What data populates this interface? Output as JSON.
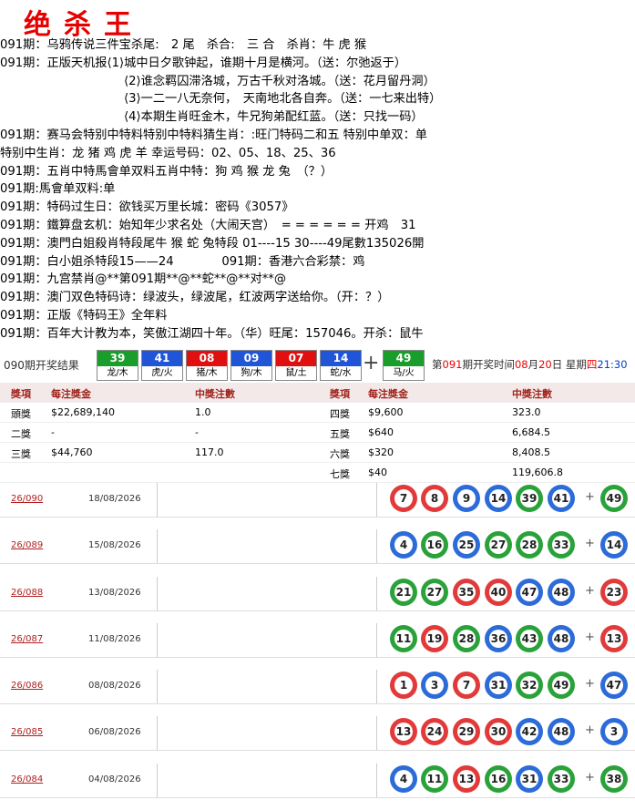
{
  "title": "绝杀王",
  "lines": [
    "091期：乌鸦传说三件宝杀尾:　2 尾　杀合:　三 合　杀肖：牛 虎 猴",
    "091期：正版天机报⟨1⟩城中日夕歌钟起，谁期十月是横河。（送：尔弛返于）",
    "⟨2⟩谁念羁囚滞洛城，万古千秋对洛城。（送：花月留丹洞）",
    "⟨3⟩一二一八无奈何，　天南地北各自奔。（送：一七来出特）",
    "⟨4⟩本期生肖旺金木，牛兄狗弟配红蓝。（送：只找一码）",
    "091期：赛马会特别中特料特别中特料猜生肖：:旺门特码二和五 特别中单双：单",
    "特别中生肖：龙 猪 鸡 虎 羊 幸运号码：02、05、18、25、36",
    "091期：五肖中特馬會单双料五肖中特：狗 鸡 猴 龙 兔　（？）",
    "091期:馬會单双料:单",
    "091期：特码过生日：欲钱买万里长城：密码《3057》",
    "091期：鐵算盘玄机：始知年少求名处（大闹天宫）　= = = = = = 开鸡　31",
    "091期：澳門白姐殺肖特段尾牛 猴 蛇 兔特段 01----15 30----49尾數135026開",
    "091期：白小姐杀特段15——24　　　　091期：香港六合彩禁：鸡",
    "091期：九宫禁肖@**第091期**@**蛇**@**对**@",
    "091期：澳门双色特码诗：绿波头，绿波尾，红波两字送给你。（开：？）",
    "091期：正版《特码王》全年料",
    "091期：百年大计教为本，笑傲江湖四十年。（华）旺尾：157046。开杀：鼠牛"
  ],
  "draw": {
    "label": "090期开奖结果",
    "balls": [
      {
        "num": "39",
        "zodiac": "龙/木",
        "color": "#1a9e2b"
      },
      {
        "num": "41",
        "zodiac": "虎/火",
        "color": "#1f55d6"
      },
      {
        "num": "08",
        "zodiac": "猪/木",
        "color": "#e01010"
      },
      {
        "num": "09",
        "zodiac": "狗/木",
        "color": "#1f55d6"
      },
      {
        "num": "07",
        "zodiac": "鼠/土",
        "color": "#e01010"
      },
      {
        "num": "14",
        "zodiac": "蛇/水",
        "color": "#1f55d6"
      }
    ],
    "plus": "+",
    "special": {
      "num": "49",
      "zodiac": "马/火",
      "color": "#1a9e2b"
    },
    "time_prefix": "第",
    "time_period": "091",
    "time_mid": "期开奖时间",
    "time_month": "08",
    "time_m": "月",
    "time_day": "20",
    "time_d": "日 星期",
    "time_weekday": "四",
    "time_clock": "21:30"
  },
  "prize": {
    "headers": [
      "獎項",
      "每注獎金",
      "中獎注數",
      "獎項",
      "每注獎金",
      "中獎注數"
    ],
    "rows": [
      [
        "頭獎",
        "$22,689,140",
        "1.0",
        "四獎",
        "$9,600",
        "323.0"
      ],
      [
        "二獎",
        "-",
        "-",
        "五獎",
        "$640",
        "6,684.5"
      ],
      [
        "三獎",
        "$44,760",
        "117.0",
        "六獎",
        "$320",
        "8,408.5"
      ],
      [
        "",
        "",
        "",
        "七獎",
        "$40",
        "119,606.8"
      ]
    ]
  },
  "history": [
    {
      "period": "26/090",
      "date": "18/08/2026",
      "nums": [
        "7",
        "8",
        "9",
        "14",
        "39",
        "41"
      ],
      "special": "49"
    },
    {
      "period": "26/089",
      "date": "15/08/2026",
      "nums": [
        "4",
        "16",
        "25",
        "27",
        "28",
        "33"
      ],
      "special": "14"
    },
    {
      "period": "26/088",
      "date": "13/08/2026",
      "nums": [
        "21",
        "27",
        "35",
        "40",
        "47",
        "48"
      ],
      "special": "23"
    },
    {
      "period": "26/087",
      "date": "11/08/2026",
      "nums": [
        "11",
        "19",
        "28",
        "36",
        "43",
        "48"
      ],
      "special": "13"
    },
    {
      "period": "26/086",
      "date": "08/08/2026",
      "nums": [
        "1",
        "3",
        "7",
        "31",
        "32",
        "49"
      ],
      "special": "47"
    },
    {
      "period": "26/085",
      "date": "06/08/2026",
      "nums": [
        "13",
        "24",
        "29",
        "30",
        "42",
        "48"
      ],
      "special": "3"
    },
    {
      "period": "26/084",
      "date": "04/08/2026",
      "nums": [
        "4",
        "11",
        "13",
        "16",
        "31",
        "33"
      ],
      "special": "38"
    }
  ],
  "colors": {
    "red": "#e23a3a",
    "blue": "#2c6bd8",
    "green": "#2aa23a"
  }
}
